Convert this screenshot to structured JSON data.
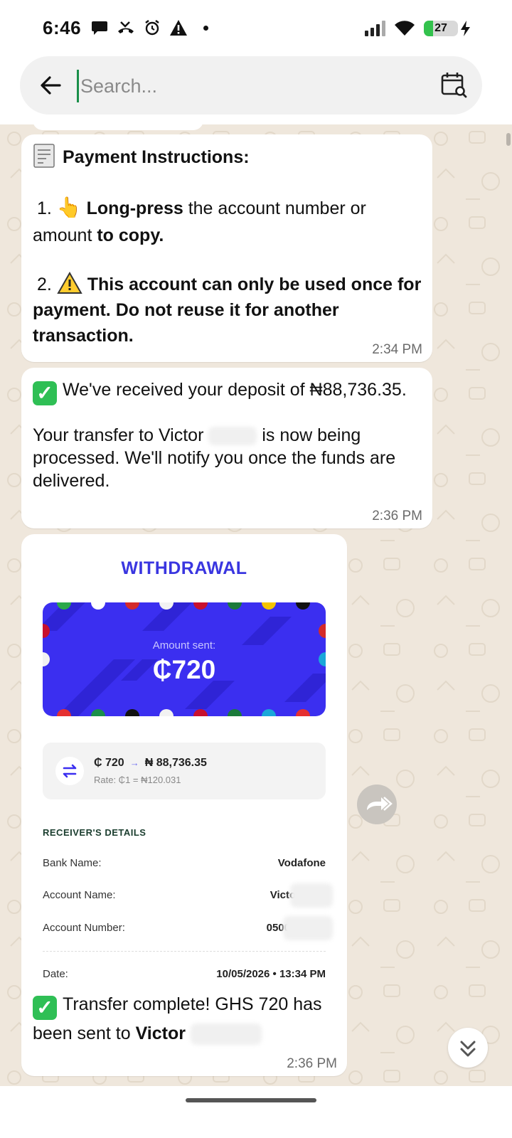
{
  "status_bar": {
    "time": "6:46",
    "battery": "27",
    "left_icons": [
      "chat-icon",
      "missed-call-icon",
      "alarm-icon",
      "warning-icon",
      "dot-icon"
    ],
    "right_icons": [
      "signal-icon",
      "wifi-icon",
      "battery-icon",
      "charging-icon"
    ]
  },
  "search": {
    "placeholder": "Search...",
    "value": ""
  },
  "messages": {
    "m1": {
      "title": "Payment Instructions:",
      "line1_num": "1.",
      "line1_bold1": "Long-press",
      "line1_text1": " the account number or amount ",
      "line1_bold2": "to copy.",
      "line2_num": "2.",
      "line2_bold": "This account can only be used once for payment. Do not reuse it for another transaction.",
      "time": "2:34 PM"
    },
    "m2": {
      "line1": "We've received your deposit of ₦88,736.35.",
      "line2a": "Your transfer to Victor",
      "line2b": "is now being processed. We'll notify you once the funds are delivered.",
      "time": "2:36 PM"
    },
    "m3": {
      "receipt": {
        "title": "WITHDRAWAL",
        "amount_label": "Amount sent:",
        "amount": "₵720",
        "from_amount": "₵ 720",
        "to_amount": "₦ 88,736.35",
        "rate": "Rate: ₵1 = ₦120.031",
        "section": "RECEIVER'S DETAILS",
        "bank_label": "Bank Name:",
        "bank_value": "Vodafone",
        "acct_name_label": "Account Name:",
        "acct_name_value": "Victor",
        "acct_num_label": "Account Number:",
        "acct_num_value": "0500",
        "date_label": "Date:",
        "date_value": "10/05/2026 • 13:34 PM"
      },
      "caption_text": "Transfer complete! GHS 720 has been sent to",
      "caption_bold": "Victor",
      "time": "2:36 PM"
    }
  },
  "colors": {
    "chat_bg": "#efe7dc",
    "brand_blue": "#3b2ff0",
    "check_green": "#2fbf55",
    "cursor_green": "#1a8f4a"
  }
}
